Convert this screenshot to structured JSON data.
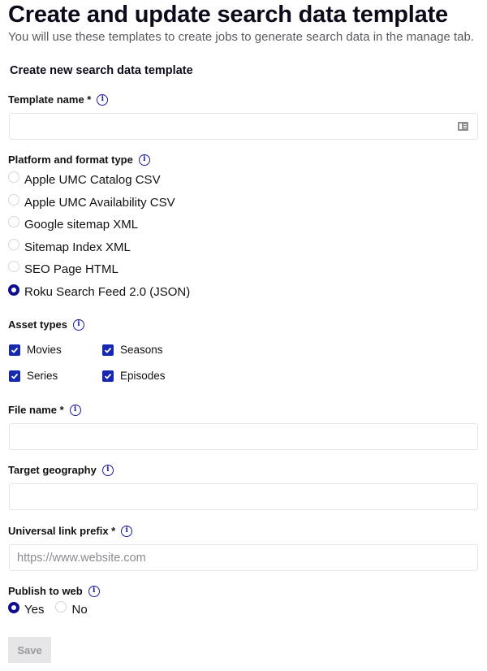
{
  "header": {
    "title": "Create and update search data template",
    "subtitle": "You will use these templates to create jobs to generate search data in the manage tab."
  },
  "section_title": "Create new search data template",
  "fields": {
    "template_name": {
      "label": "Template name *",
      "value": "",
      "placeholder": ""
    },
    "platform": {
      "label": "Platform and format type",
      "options": [
        {
          "label": "Apple UMC Catalog CSV",
          "checked": false
        },
        {
          "label": "Apple UMC Availability CSV",
          "checked": false
        },
        {
          "label": "Google sitemap XML",
          "checked": false
        },
        {
          "label": "Sitemap Index XML",
          "checked": false
        },
        {
          "label": "SEO Page HTML",
          "checked": false
        },
        {
          "label": "Roku Search Feed 2.0 (JSON)",
          "checked": true
        }
      ]
    },
    "asset_types": {
      "label": "Asset types",
      "options": [
        {
          "label": "Movies",
          "checked": true
        },
        {
          "label": "Seasons",
          "checked": true
        },
        {
          "label": "Series",
          "checked": true
        },
        {
          "label": "Episodes",
          "checked": true
        }
      ]
    },
    "file_name": {
      "label": "File name *",
      "value": "",
      "placeholder": ""
    },
    "target_geography": {
      "label": "Target geography",
      "value": "",
      "placeholder": ""
    },
    "universal_link_prefix": {
      "label": "Universal link prefix *",
      "value": "",
      "placeholder": "https://www.website.com"
    },
    "publish_to_web": {
      "label": "Publish to web",
      "options": [
        {
          "label": "Yes",
          "checked": true
        },
        {
          "label": "No",
          "checked": false
        }
      ]
    }
  },
  "icons": {
    "info": "i",
    "autofill": "contact-card-icon"
  },
  "save_label": "Save",
  "colors": {
    "accent": "#0e0e8c",
    "checkbox": "#1528b0",
    "disabled_bg": "#e6e6e8",
    "disabled_text": "#9a9a9e"
  }
}
